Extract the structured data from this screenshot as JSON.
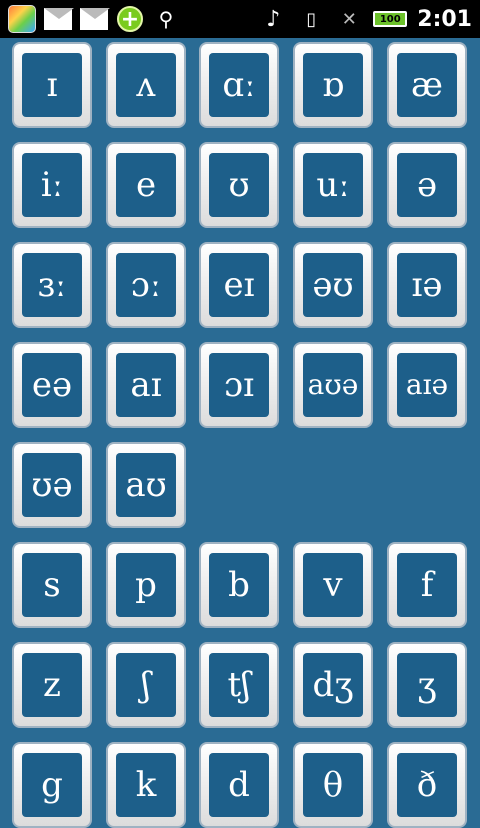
{
  "status_bar": {
    "icons": [
      "app-icon",
      "mail-icon",
      "mail-icon",
      "plus-icon",
      "usb-icon",
      "music-off-icon",
      "sd-card-icon",
      "no-signal-icon",
      "battery-icon"
    ],
    "battery_level": "100",
    "time": "2:01"
  },
  "vowels": [
    "ɪ",
    "ʌ",
    "ɑː",
    "ɒ",
    "æ",
    "iː",
    "e",
    "ʊ",
    "uː",
    "ə",
    "ɜː",
    "ɔː",
    "eɪ",
    "əʊ",
    "ɪə",
    "eə",
    "aɪ",
    "ɔɪ",
    "aʊə",
    "aɪə",
    "ʊə",
    "aʊ"
  ],
  "consonants": [
    "s",
    "p",
    "b",
    "v",
    "f",
    "z",
    "ʃ",
    "tʃ",
    "dʒ",
    "ʒ",
    "g",
    "k",
    "d",
    "θ",
    "ð"
  ]
}
